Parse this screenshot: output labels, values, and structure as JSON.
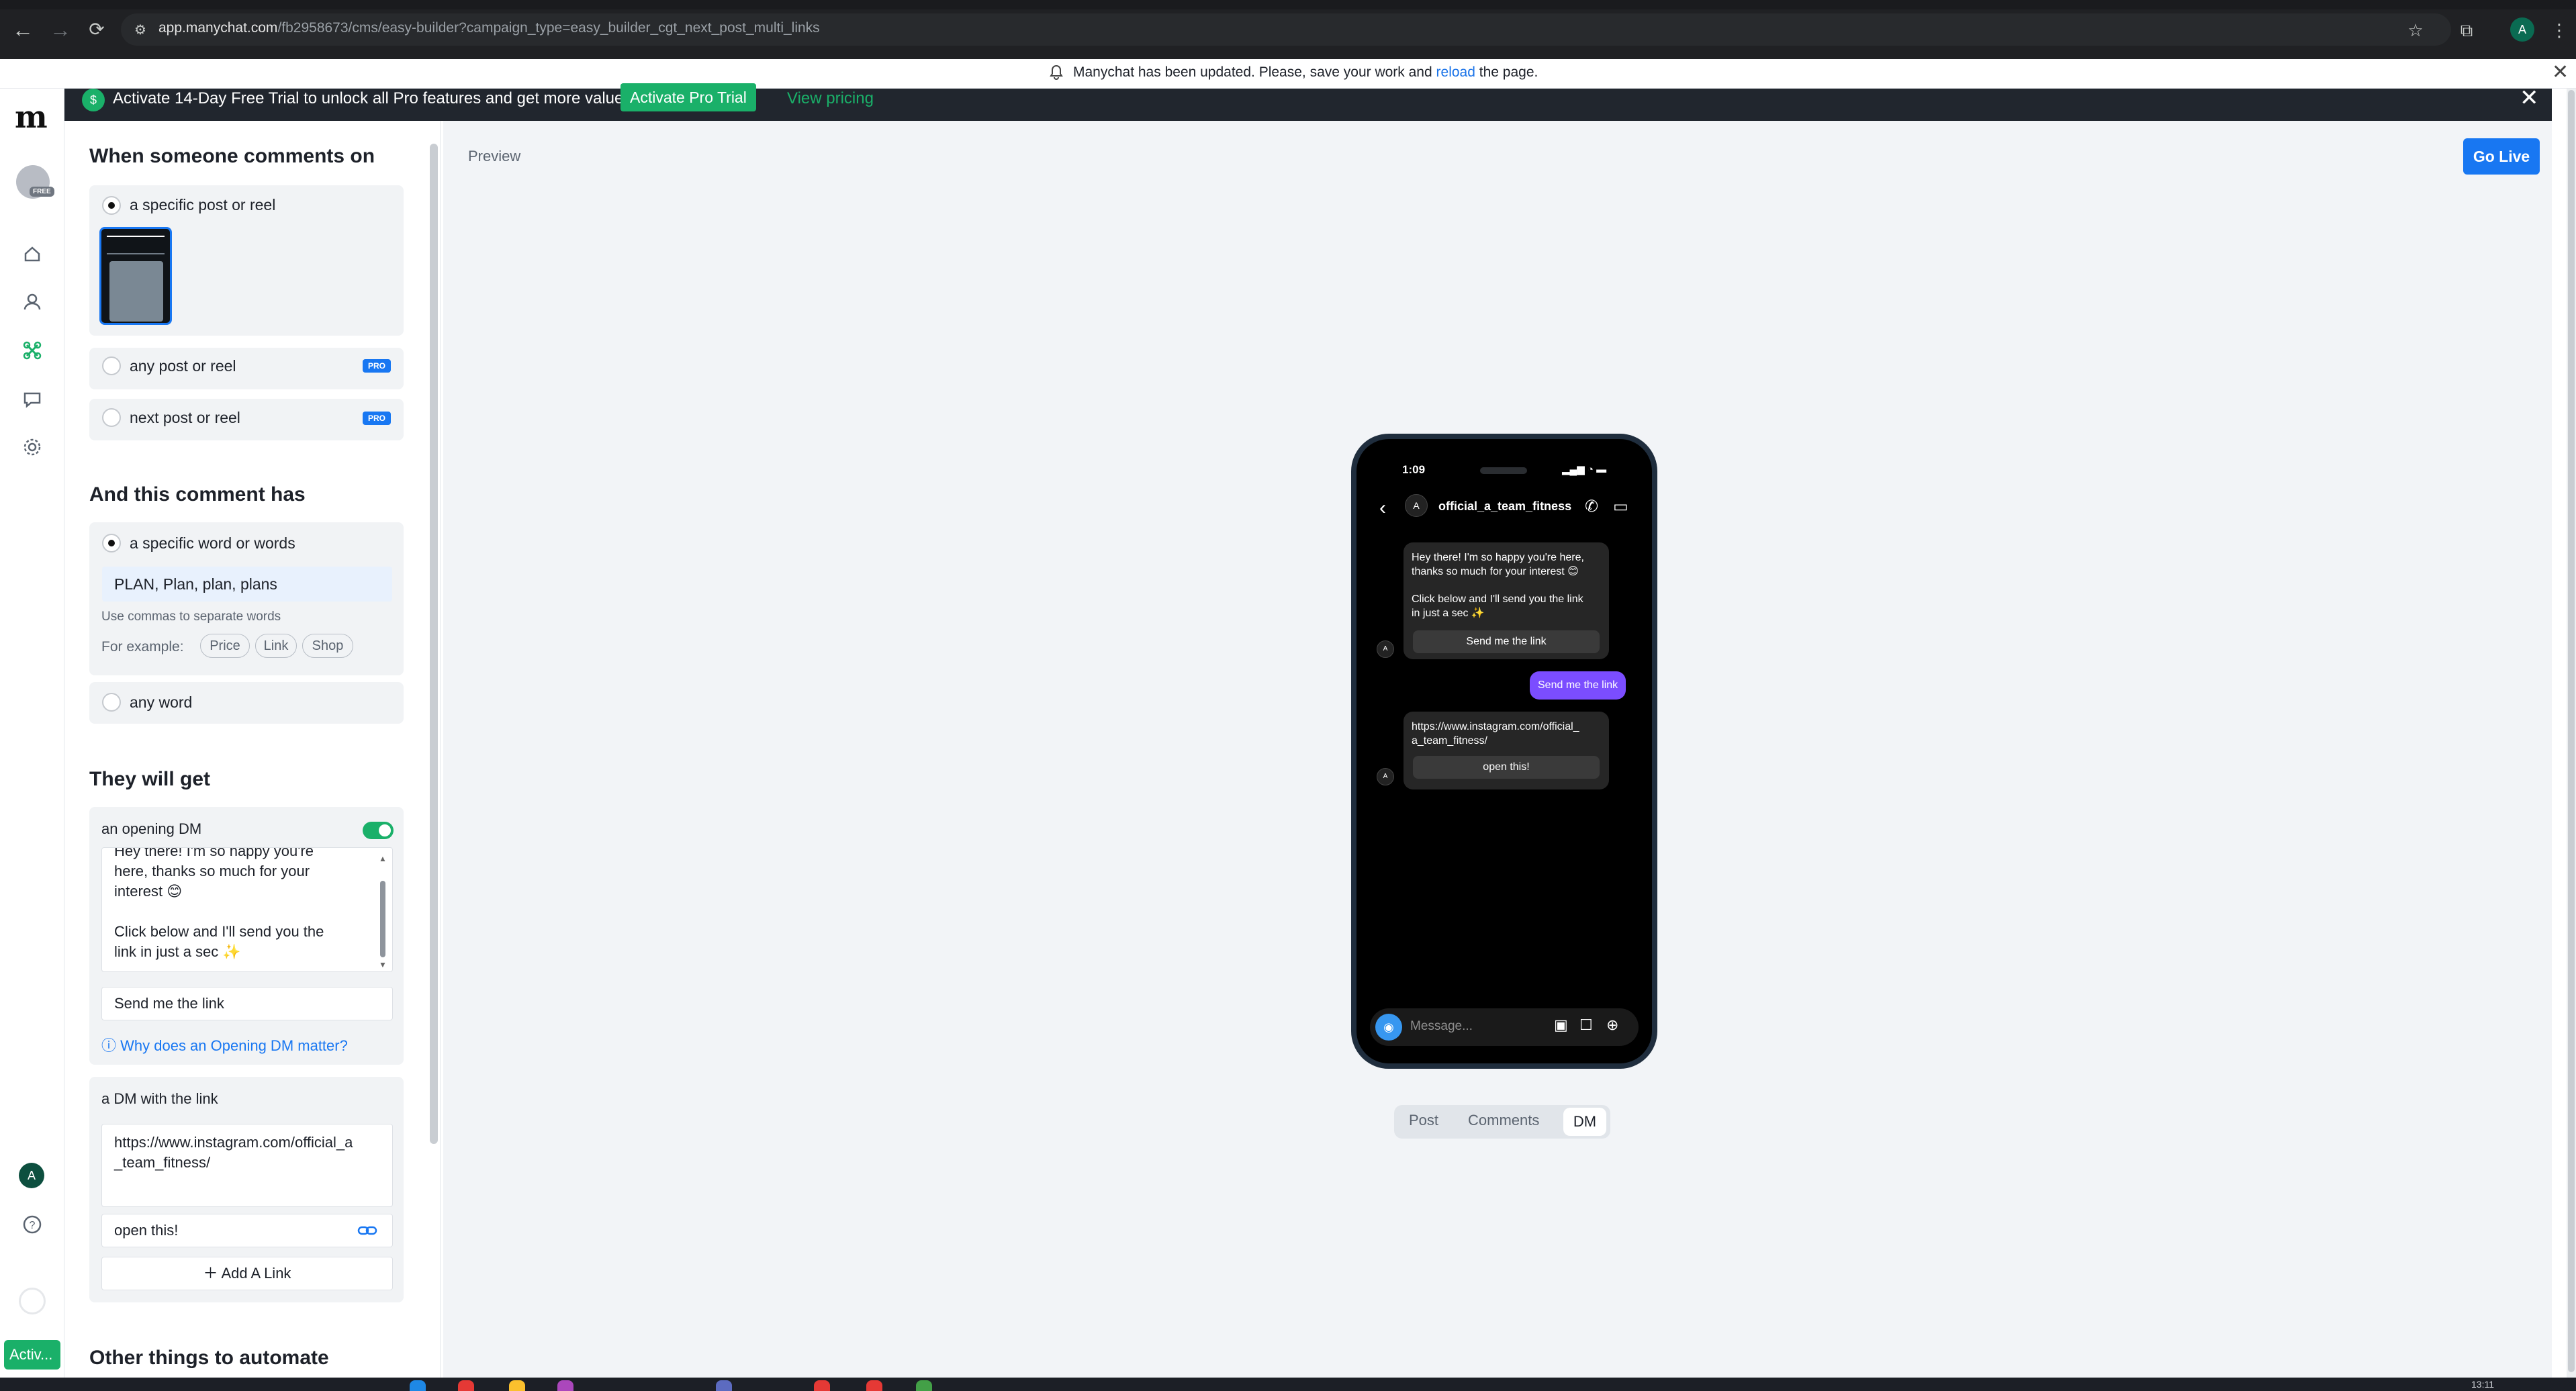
{
  "browser": {
    "url_host": "app.manychat.com",
    "url_path": "/fb2958673/cms/easy-builder?campaign_type=easy_builder_cgt_next_post_multi_links",
    "profile_initial": "A"
  },
  "update_banner": {
    "text_before": "Manychat has been updated. Please, save your work and",
    "link": "reload",
    "text_after": "the page."
  },
  "trial": {
    "text": "Activate 14-Day Free Trial to unlock all Pro features and get more value",
    "button": "Activate Pro Trial",
    "link": "View pricing"
  },
  "rail": {
    "free_tag": "FREE",
    "account_initial": "A",
    "activate_label": "Activ..."
  },
  "trigger": {
    "heading": "When someone comments on",
    "options": [
      {
        "label": "a specific post or reel",
        "selected": true
      },
      {
        "label": "any post or reel",
        "badge": "PRO"
      },
      {
        "label": "next post or reel",
        "badge": "PRO"
      }
    ]
  },
  "comment": {
    "heading": "And this comment has",
    "option_specific": "a specific word or words",
    "keywords": "PLAN, Plan, plan, plans",
    "hint": "Use commas to separate words",
    "example_label": "For example:",
    "examples": [
      "Price",
      "Link",
      "Shop"
    ],
    "option_any": "any word"
  },
  "reward": {
    "heading": "They will get",
    "opening_dm_label": "an opening DM",
    "opening_dm_line1": "Hey there! I'm so happy you're",
    "opening_dm_line2": "here, thanks so much for your",
    "opening_dm_line3": "interest 😊",
    "opening_dm_line4": "Click below and I'll send you the",
    "opening_dm_line5": "link in just a sec ✨",
    "opening_button": "Send me the link",
    "why_link": "Why does an Opening DM matter?",
    "link_dm_label": "a DM with the link",
    "link_text_line1": "https://www.instagram.com/official_a",
    "link_text_line2": "_team_fitness/",
    "link_button": "open this!",
    "add_link": "Add A Link"
  },
  "other": {
    "heading": "Other things to automate"
  },
  "preview": {
    "label": "Preview",
    "go_live": "Go Live",
    "phone": {
      "time": "1:09",
      "account": "official_a_team_fitness",
      "bubble1_line1": "Hey there! I'm so happy you're here,",
      "bubble1_line2": "thanks so much for your interest 😊",
      "bubble1_line3": "Click below and I'll send you the link",
      "bubble1_line4": "in just a sec ✨",
      "bubble1_button": "Send me the link",
      "user_reply": "Send me the link",
      "bubble2_line1": "https://www.instagram.com/official_",
      "bubble2_line2": "a_team_fitness/",
      "bubble2_button": "open this!",
      "composer_placeholder": "Message..."
    },
    "tabs": [
      "Post",
      "Comments",
      "DM"
    ],
    "active_tab": "DM"
  },
  "taskbar": {
    "clock": "13:11"
  },
  "colors": {
    "brand_green": "#1ab069",
    "accent_blue": "#1877f2",
    "dm_purple": "#7b4dff"
  }
}
